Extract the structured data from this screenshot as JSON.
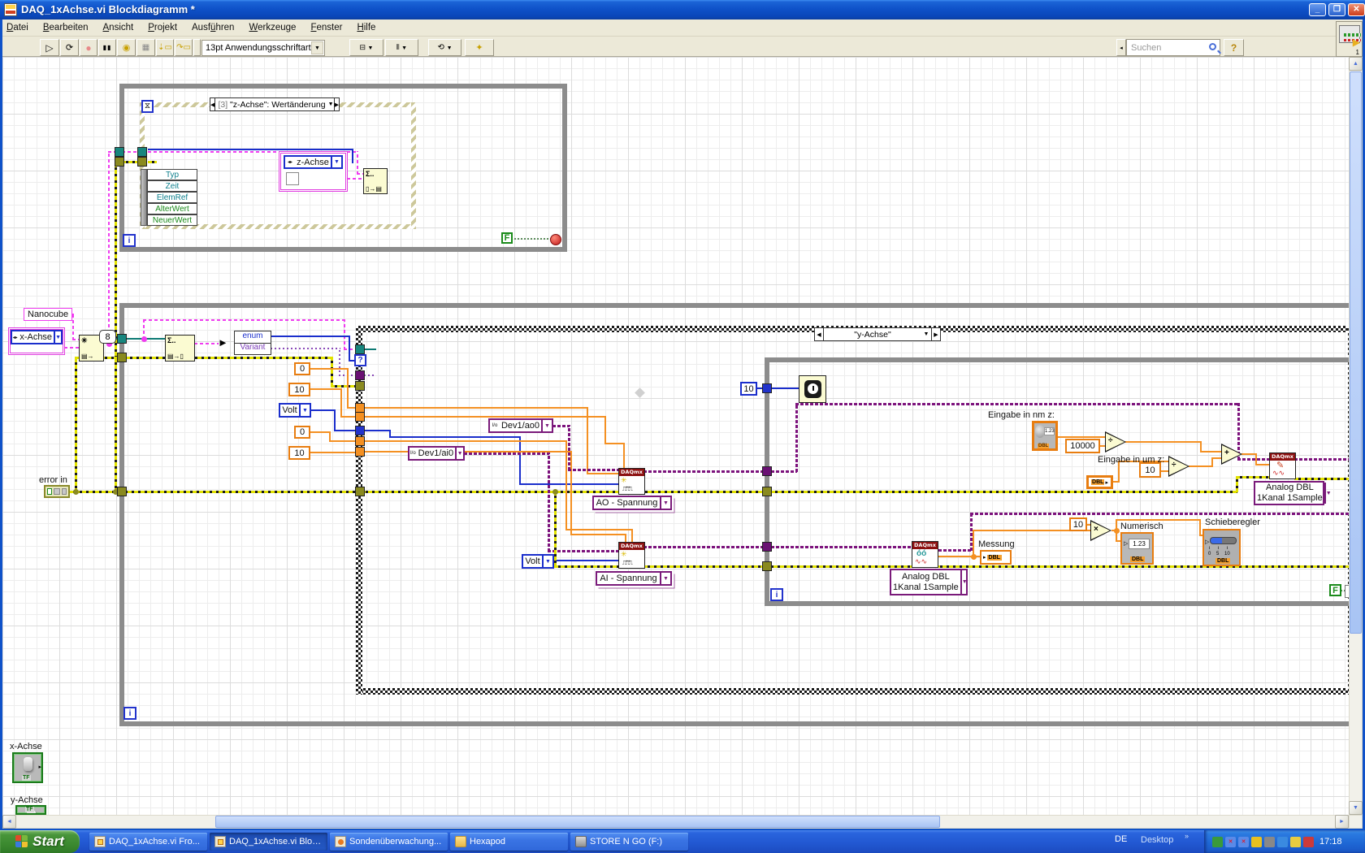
{
  "window": {
    "title": "DAQ_1xAchse.vi Blockdiagramm *"
  },
  "menu": [
    {
      "label": "Datei",
      "u": 0
    },
    {
      "label": "Bearbeiten",
      "u": 0
    },
    {
      "label": "Ansicht",
      "u": 0
    },
    {
      "label": "Projekt",
      "u": 0
    },
    {
      "label": "Ausführen",
      "u": 4
    },
    {
      "label": "Werkzeuge",
      "u": 0
    },
    {
      "label": "Fenster",
      "u": 0
    },
    {
      "label": "Hilfe",
      "u": 0
    }
  ],
  "toolbar": {
    "font": "13pt Anwendungsschriftart",
    "search_placeholder": "Suchen",
    "help": "?"
  },
  "vi_icon_badge": "1",
  "diagram": {
    "event_selector": {
      "prefix": "[3]",
      "text": " \"z-Achse\": Wertänderung"
    },
    "case_selector": {
      "prefix": "",
      "text": "\"y-Achse\""
    },
    "event_rows": [
      "Typ",
      "Zeit",
      "ElemRef",
      "AlterWert",
      "NeuerWert"
    ],
    "texts": {
      "nanocube": "Nanocube",
      "x_achse_ring": "x-Achse",
      "z_achse_ring": "z-Achse",
      "volt1": "Volt",
      "volt2": "Volt",
      "dev_ao": "Dev1/ao0",
      "dev_ai": "Dev1/ai0",
      "ao_sp": "AO - Spannung",
      "ai_sp": "AI - Spannung",
      "analog_r1": "Analog DBL",
      "analog_r2": "1Kanal 1Sample",
      "analog_w1": "Analog DBL",
      "analog_w2": "1Kanal 1Sample",
      "c0a": "0",
      "c10a": "10",
      "c0b": "0",
      "c10b": "10",
      "c8": "8",
      "c10w": "10",
      "c10000": "10000",
      "c10d": "10",
      "c10c": "10",
      "f1": "F",
      "f3": "F",
      "i1": "i",
      "i2": "i",
      "i3": "i",
      "qsel": "?",
      "error_in": "error in",
      "eingabe_nm": "Eingabe in nm z:",
      "eingabe_um": "Eingabe in µm z:",
      "messung": "Messung",
      "numerisch": "Numerisch",
      "schieberegler": "Schieberegler",
      "x_achse_label": "x-Achse",
      "y_achse_label": "y-Achse",
      "enum": "enum",
      "variant": "Variant",
      "daqmx": "DAQmx",
      "dbl": "DBL",
      "tf": "TF",
      "sigma": "Σ..",
      "knob_val": "1.23",
      "num_val": "1.23",
      "tick0": "0",
      "tick5": "5",
      "tick10": "10"
    }
  },
  "taskbar": {
    "start": "Start",
    "tasks": [
      {
        "label": "DAQ_1xAchse.vi Fro...",
        "icon": "lv",
        "active": false
      },
      {
        "label": "DAQ_1xAchse.vi Bloc...",
        "icon": "lv",
        "active": true
      },
      {
        "label": "Sondenüberwachung...",
        "icon": "app",
        "active": false
      },
      {
        "label": "Hexapod",
        "icon": "folder",
        "active": false
      },
      {
        "label": "STORE N GO (F:)",
        "icon": "drive",
        "active": false
      }
    ],
    "lang": "DE",
    "desktop": "Desktop",
    "chevron": "»",
    "time": "17:18"
  }
}
